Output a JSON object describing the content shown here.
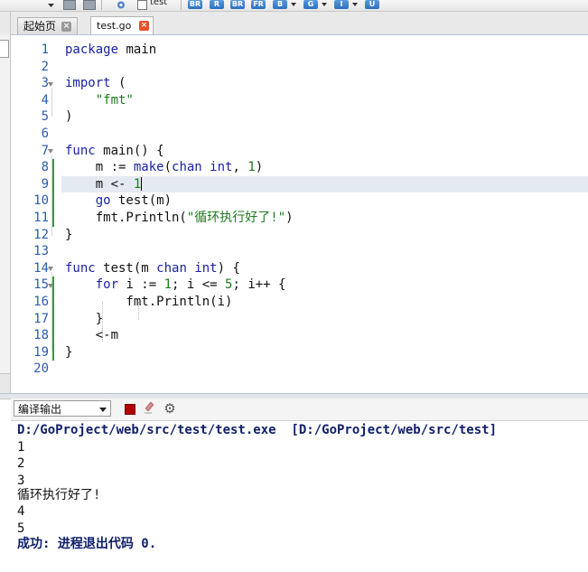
{
  "toolbar": {
    "checkbox_label": "test",
    "buttons": [
      "BR",
      "R",
      "BR",
      "FR",
      "B",
      "G",
      "I",
      "U"
    ]
  },
  "tabs": [
    {
      "label": "起始页",
      "active": false
    },
    {
      "label": "test.go",
      "active": true
    }
  ],
  "editor": {
    "line_numbers": [
      "1",
      "2",
      "3",
      "4",
      "5",
      "6",
      "7",
      "8",
      "9",
      "10",
      "11",
      "12",
      "13",
      "14",
      "15",
      "16",
      "17",
      "18",
      "19",
      "20"
    ],
    "current_line": 9
  },
  "output": {
    "panel_select": "编译输出",
    "header": "D:/GoProject/web/src/test/test.exe  [D:/GoProject/web/src/test]",
    "lines": [
      "1",
      "2",
      "3",
      "循环执行好了!",
      "4",
      "5"
    ],
    "status": "成功: 进程退出代码 0."
  },
  "colors": {
    "keyword": "#1a22a8",
    "string": "#1d7a1d",
    "line_number": "#2a5db0",
    "current_line_bg": "#e4eaf1",
    "change_bar": "#3a9a3a",
    "active_tab_close": "#e8502a"
  }
}
